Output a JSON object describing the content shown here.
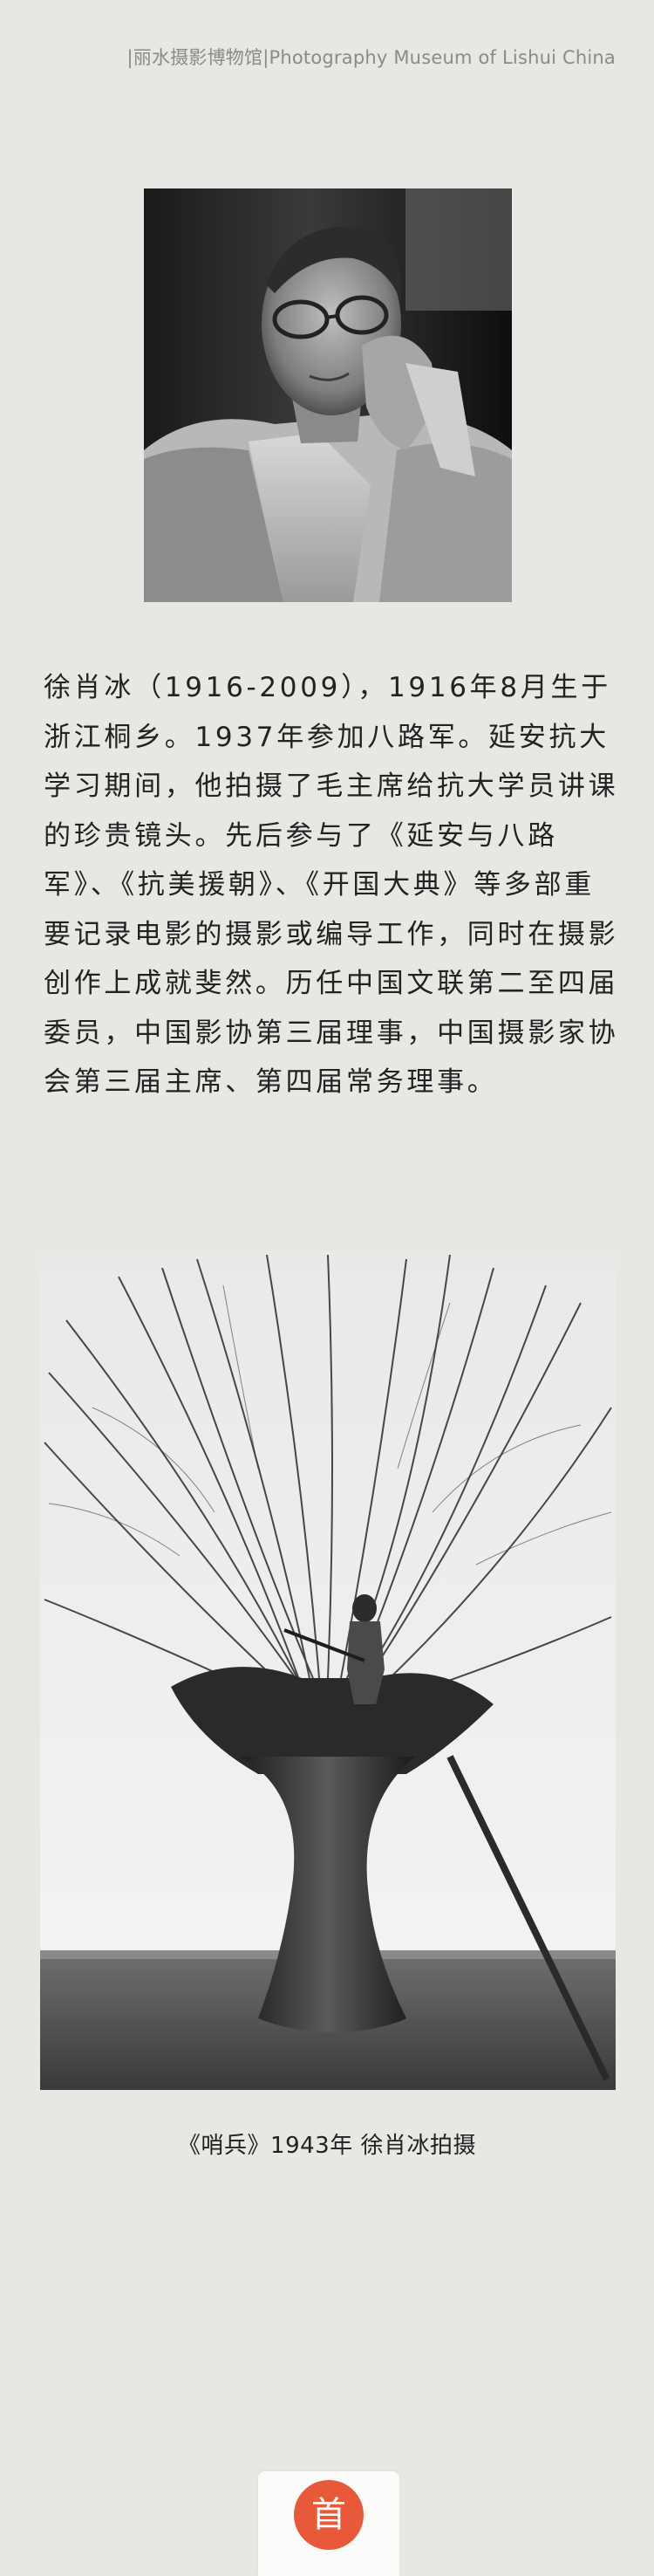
{
  "header": {
    "title": "|丽水摄影博物馆|Photography Museum of Lishui China"
  },
  "bio": {
    "text": "徐肖冰（1916-2009），1916年8月生于浙江桐乡。1937年参加八路军。延安抗大学习期间，他拍摄了毛主席给抗大学员讲课的珍贵镜头。先后参与了《延安与八路军》、《抗美援朝》、《开国大典》等多部重要记录电影的摄影或编导工作，同时在摄影创作上成就斐然。历任中国文联第二至四届委员，中国影协第三届理事，中国摄影家协会第三届主席、第四届常务理事。"
  },
  "photo": {
    "caption": "《哨兵》1943年  徐肖冰拍摄"
  },
  "footer": {
    "home_label": "首",
    "accent_color": "#e8593a"
  }
}
